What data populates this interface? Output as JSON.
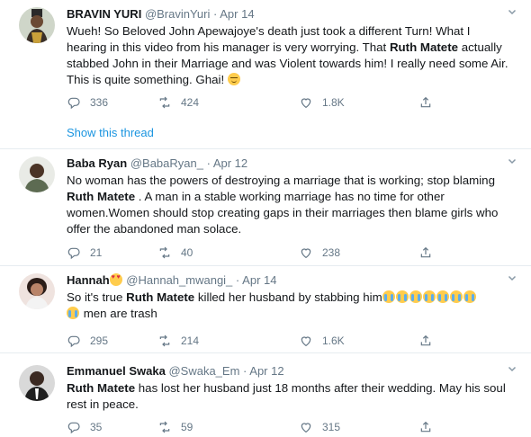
{
  "colors": {
    "text": "#14171a",
    "muted": "#657786",
    "link": "#1b95e0",
    "divider": "#e6ecf0"
  },
  "icons": {
    "reply": "reply-icon",
    "retweet": "retweet-icon",
    "like": "like-icon",
    "share": "share-icon",
    "caret": "chevron-down-icon"
  },
  "tweets": [
    {
      "name": "BRAVIN YURI",
      "handle": "@BravinYuri",
      "dot": "·",
      "date": "Apr 14",
      "text_parts": [
        "Wueh! So Beloved John Apewajoye's death just took a different Turn! What I hearing in this video from his manager is very worrying. That ",
        "Ruth Matete",
        " actually stabbed John in their Marriage and was Violent towards him! I really need some Air. This is quite something. Ghai! "
      ],
      "emoji": "relieved-face",
      "replies": "336",
      "retweets": "424",
      "likes": "1.8K",
      "show_thread": "Show this thread"
    },
    {
      "name": "Baba Ryan",
      "handle": "@BabaRyan_",
      "dot": "·",
      "date": "Apr 12",
      "text_parts": [
        "No woman has the powers of destroying a marriage that is working; stop blaming ",
        "Ruth Matete",
        " . A man in a stable working marriage has no time for other women.Women should stop creating gaps in their marriages then blame girls who offer the abandoned man solace."
      ],
      "replies": "21",
      "retweets": "40",
      "likes": "238"
    },
    {
      "name": "Hannah",
      "name_emoji": "smiling-face-with-heart-eyes",
      "handle": "@Hannah_mwangi_",
      "dot": "·",
      "date": "Apr 14",
      "text_parts": [
        "So it's true ",
        "Ruth Matete",
        " killed her husband by stabbing him",
        " men are trash"
      ],
      "emoji": "loudly-crying-face",
      "replies": "295",
      "retweets": "214",
      "likes": "1.6K"
    },
    {
      "name": "Emmanuel Swaka",
      "handle": "@Swaka_Em",
      "dot": "·",
      "date": "Apr 12",
      "text_parts": [
        "Ruth Matete",
        " has lost her husband just 18 months after their wedding. May his soul rest in peace."
      ],
      "replies": "35",
      "retweets": "59",
      "likes": "315"
    }
  ]
}
